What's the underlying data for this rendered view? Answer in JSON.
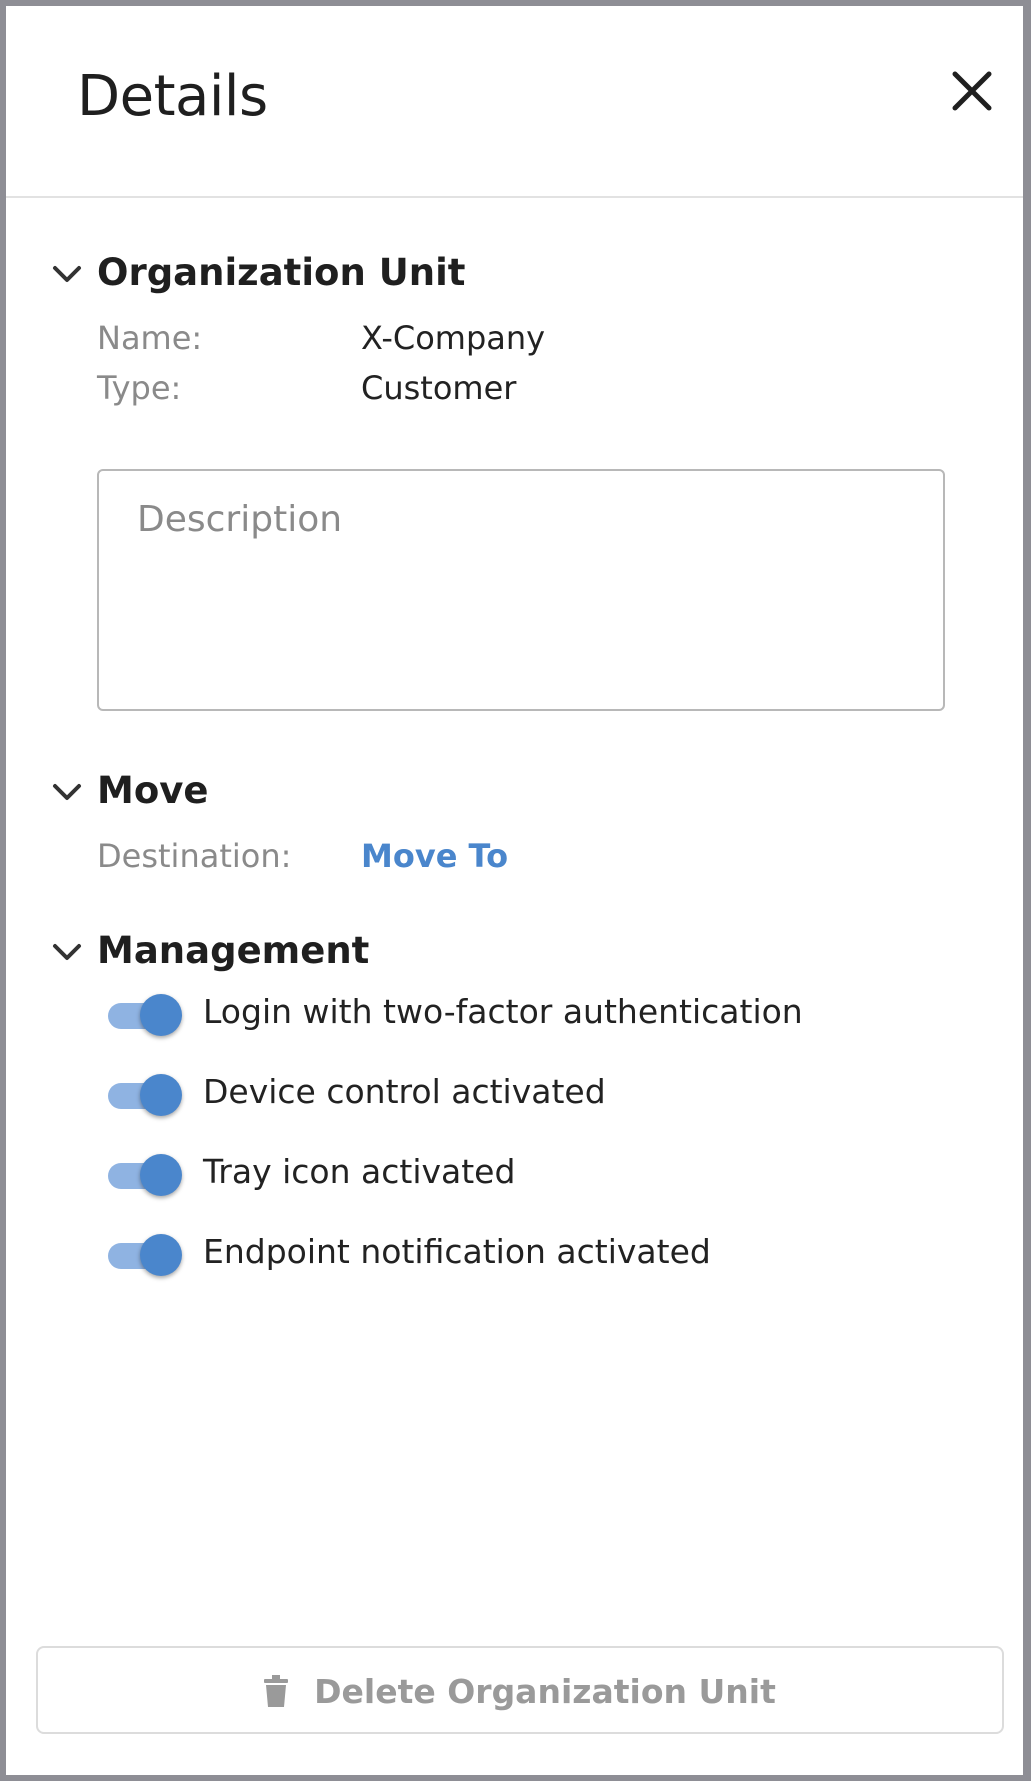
{
  "header": {
    "title": "Details",
    "close_icon": "close-icon"
  },
  "org_unit": {
    "title": "Organization Unit",
    "expanded": true,
    "name_label": "Name:",
    "name_value": "X-Company",
    "type_label": "Type:",
    "type_value": "Customer",
    "description_value": "",
    "description_placeholder": "Description"
  },
  "move": {
    "title": "Move",
    "expanded": true,
    "destination_label": "Destination:",
    "destination_link": "Move To"
  },
  "management": {
    "title": "Management",
    "expanded": true,
    "toggles": [
      {
        "label": "Login with two-factor authentication",
        "on": true
      },
      {
        "label": "Device control activated",
        "on": true
      },
      {
        "label": "Tray icon activated",
        "on": true
      },
      {
        "label": "Endpoint notification activated",
        "on": true
      }
    ]
  },
  "footer": {
    "delete_label": "Delete Organization Unit",
    "delete_icon": "trash-icon"
  },
  "colors": {
    "accent": "#4a86cc",
    "accent_light": "#8fb3e2",
    "muted_text": "#8a8a8a",
    "border": "#8e8e95"
  }
}
